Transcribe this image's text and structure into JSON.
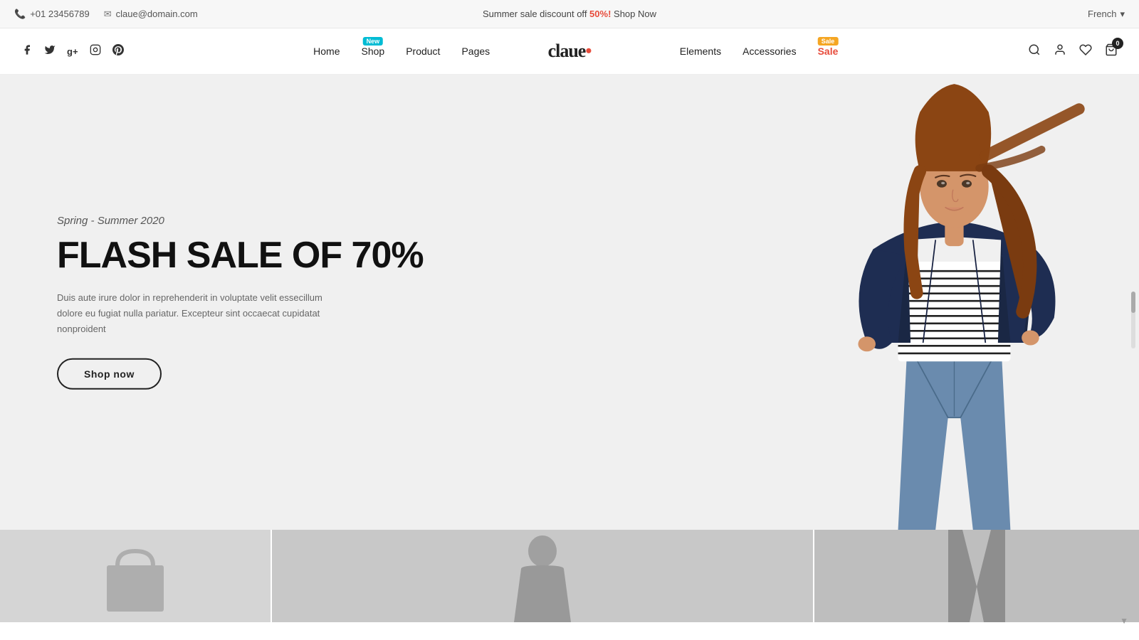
{
  "topbar": {
    "phone": "+01 23456789",
    "email": "claue@domain.com",
    "promo_text": "Summer sale discount off ",
    "promo_highlight": "50%!",
    "promo_link": "Shop Now",
    "language": "French",
    "language_dropdown": "▾"
  },
  "header": {
    "logo": "claue",
    "logo_dot": "•",
    "nav": [
      {
        "label": "Home",
        "badge": null
      },
      {
        "label": "Shop",
        "badge": "New"
      },
      {
        "label": "Product",
        "badge": null
      },
      {
        "label": "Pages",
        "badge": null
      },
      {
        "label": "Elements",
        "badge": null
      },
      {
        "label": "Accessories",
        "badge": null
      },
      {
        "label": "Sale",
        "badge": "Sale",
        "badge_type": "sale",
        "class": "sale"
      }
    ],
    "cart_count": "0"
  },
  "hero": {
    "subtitle": "Spring - Summer 2020",
    "title": "FLASH SALE OF 70%",
    "description": "Duis aute irure dolor in reprehenderit in voluptate velit essecillum dolore eu fugiat nulla pariatur. Excepteur sint occaecat cupidatat nonproident",
    "cta": "Shop now"
  },
  "social": [
    {
      "name": "facebook",
      "icon": "f"
    },
    {
      "name": "twitter",
      "icon": "t"
    },
    {
      "name": "google-plus",
      "icon": "g+"
    },
    {
      "name": "instagram",
      "icon": "ig"
    },
    {
      "name": "pinterest",
      "icon": "p"
    }
  ],
  "colors": {
    "accent_red": "#e74c3c",
    "accent_cyan": "#00bcd4",
    "accent_orange": "#f5a623",
    "text_dark": "#222222",
    "text_muted": "#666666",
    "bg_hero": "#f0f0f0"
  }
}
